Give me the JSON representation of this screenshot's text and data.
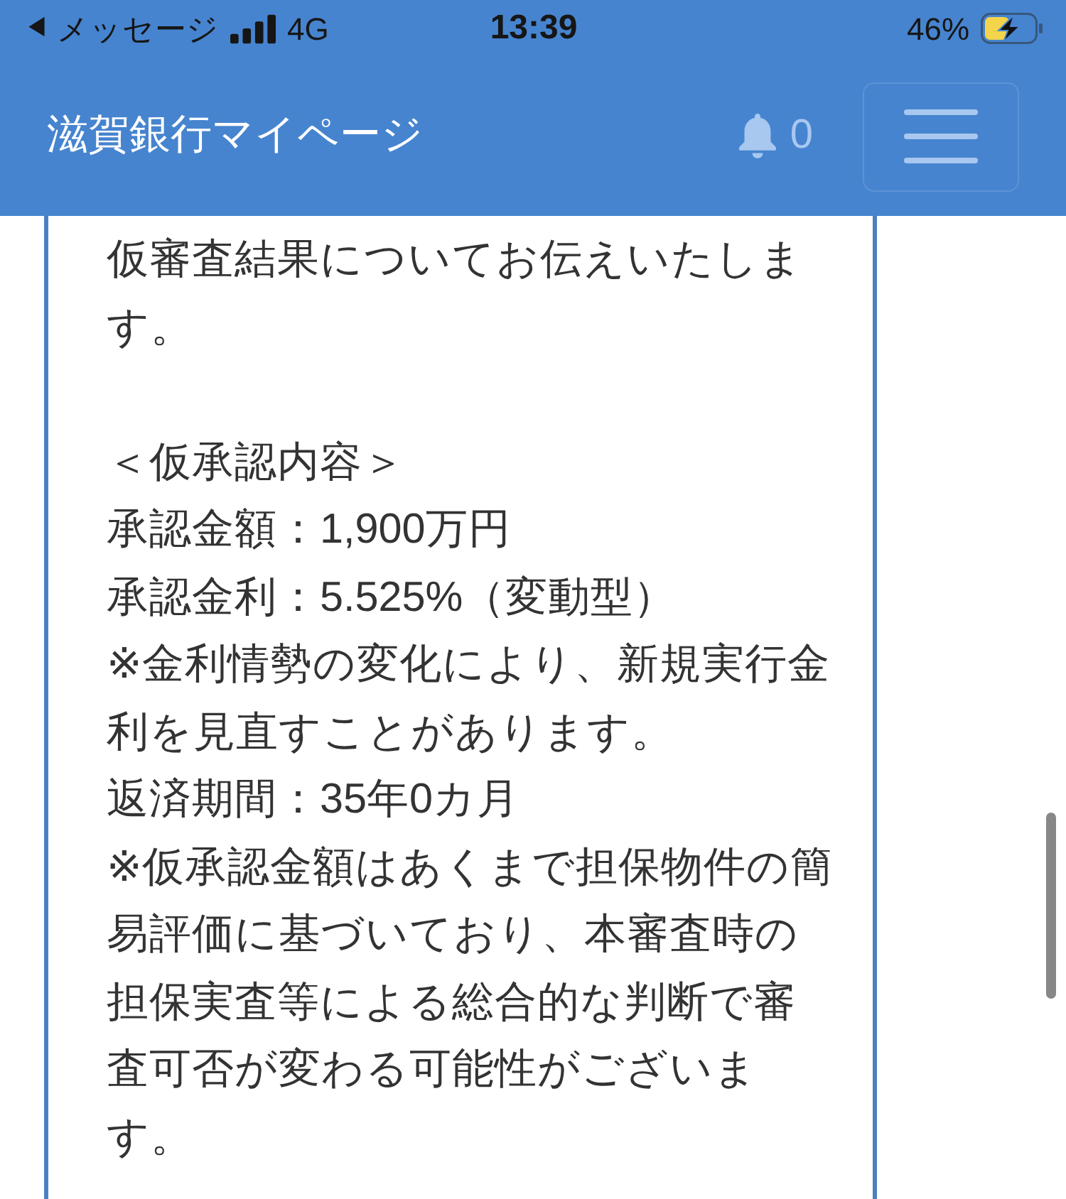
{
  "status_bar": {
    "back_arrow": "◀",
    "back_label": "メッセージ",
    "network": "4G",
    "time": "13:39",
    "battery": "46%"
  },
  "navbar": {
    "brand": "滋賀銀行マイページ",
    "notification_count": "0"
  },
  "message": {
    "paragraphs": [
      {
        "lines": [
          "仮審査結果についてお伝えいたします。"
        ]
      },
      {
        "lines": [
          "＜仮承認内容＞",
          "承認金額：1,900万円",
          "承認金利：5.525%（変動型）",
          "※金利情勢の変化により、新規実行金利を見直すことがあります。",
          "返済期間：35年0カ月",
          "※仮承認金額はあくまで担保物件の簡易評価に基づいており、本審査時の担保実査等による総合的な判断で審査可否が変わる可能性がございます。"
        ]
      }
    ]
  }
}
